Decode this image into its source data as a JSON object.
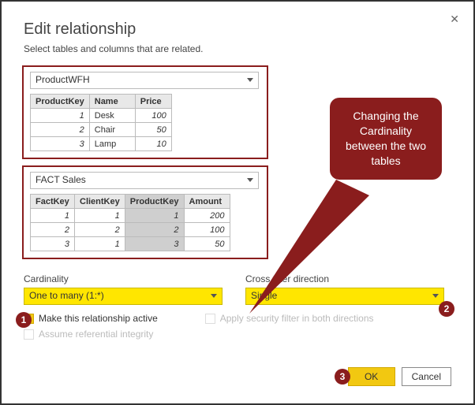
{
  "dialog": {
    "title": "Edit relationship",
    "subtitle": "Select tables and columns that are related.",
    "close_glyph": "✕"
  },
  "table1": {
    "selected": "ProductWFH",
    "headers": [
      "ProductKey",
      "Name",
      "Price"
    ],
    "rows": [
      {
        "ProductKey": "1",
        "Name": "Desk",
        "Price": "100"
      },
      {
        "ProductKey": "2",
        "Name": "Chair",
        "Price": "50"
      },
      {
        "ProductKey": "3",
        "Name": "Lamp",
        "Price": "10"
      }
    ]
  },
  "table2": {
    "selected": "FACT Sales",
    "headers": [
      "FactKey",
      "ClientKey",
      "ProductKey",
      "Amount"
    ],
    "highlight_col": "ProductKey",
    "rows": [
      {
        "FactKey": "1",
        "ClientKey": "1",
        "ProductKey": "1",
        "Amount": "200"
      },
      {
        "FactKey": "2",
        "ClientKey": "2",
        "ProductKey": "2",
        "Amount": "100"
      },
      {
        "FactKey": "3",
        "ClientKey": "1",
        "ProductKey": "3",
        "Amount": "50"
      }
    ]
  },
  "cardinality": {
    "label": "Cardinality",
    "value": "One to many (1:*)"
  },
  "crossfilter": {
    "label": "Cross filter direction",
    "value": "Single"
  },
  "checks": {
    "active": "Make this relationship active",
    "security": "Apply security filter in both directions",
    "integrity": "Assume referential integrity"
  },
  "buttons": {
    "ok": "OK",
    "cancel": "Cancel"
  },
  "callout": {
    "text": "Changing the Cardinality between the two tables"
  },
  "markers": {
    "m1": "1",
    "m2": "2",
    "m3": "3"
  }
}
